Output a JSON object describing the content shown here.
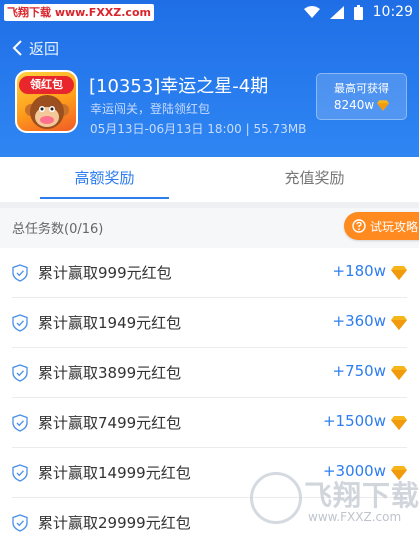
{
  "status_bar": {
    "watermark_left": "飞翔下载",
    "watermark_url": "www.FXXZ.com",
    "time": "10:29"
  },
  "header": {
    "back_label": "返回",
    "app_icon_badge": "领红包",
    "app_title": "[10353]幸运之星-4期",
    "app_subtitle": "幸运闯关，登陆领红包",
    "app_meta": "05月13日-06月13日 18:00 | 55.73MB",
    "max_label": "最高可获得",
    "max_value": "8240w"
  },
  "tabs": [
    {
      "label": "高额奖励",
      "active": true
    },
    {
      "label": "充值奖励",
      "active": false
    }
  ],
  "summary": {
    "text": "总任务数(0/16)",
    "guide_button": "试玩攻略"
  },
  "tasks": [
    {
      "label": "累计赢取999元红包",
      "reward": "+180w"
    },
    {
      "label": "累计赢取1949元红包",
      "reward": "+360w"
    },
    {
      "label": "累计赢取3899元红包",
      "reward": "+750w"
    },
    {
      "label": "累计赢取7499元红包",
      "reward": "+1500w"
    },
    {
      "label": "累计赢取14999元红包",
      "reward": "+3000w"
    },
    {
      "label": "累计赢取29999元红包",
      "reward": ""
    }
  ],
  "watermark": {
    "text": "飞翔下载",
    "url": "www.FXXZ.com"
  },
  "colors": {
    "header_blue": "#1f6ee6",
    "accent_blue": "#2d7df0",
    "guide_orange": "#ff8a1f",
    "gem_gold": "#f5b51b"
  },
  "icons": {
    "back": "chevron-left-icon",
    "shield": "shield-check-icon",
    "gem": "diamond-icon",
    "guide": "question-circle-icon"
  }
}
